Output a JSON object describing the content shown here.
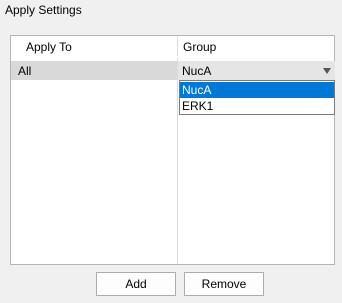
{
  "group_title": "Apply Settings",
  "table": {
    "headers": [
      "Apply To",
      "Group"
    ],
    "rows": [
      {
        "apply_to": "All",
        "group": "NucA"
      }
    ]
  },
  "dropdown": {
    "options": [
      "NucA",
      "ERK1"
    ],
    "selected": "NucA"
  },
  "buttons": {
    "add": "Add",
    "remove": "Remove"
  },
  "colors": {
    "selection": "#0078d7",
    "row_highlight": "#d9d9d9"
  }
}
